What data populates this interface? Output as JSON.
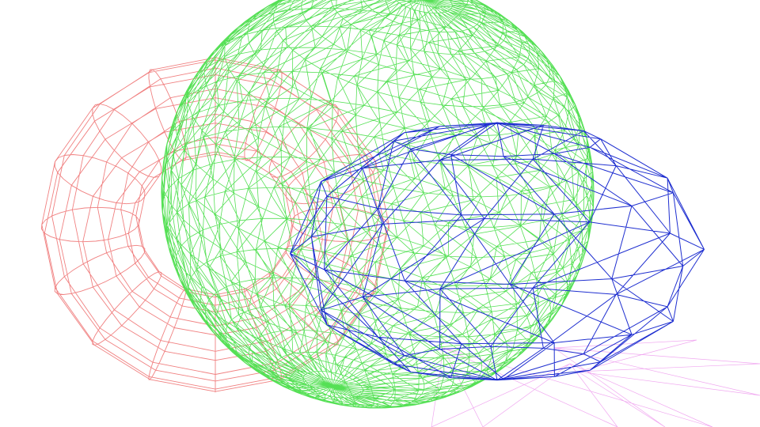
{
  "scene": {
    "background": "#ffffff",
    "objects": [
      {
        "name": "torus-wireframe",
        "shape": "torus",
        "color": "#f08080"
      },
      {
        "name": "sphere-wireframe",
        "shape": "geodesic-sphere",
        "color": "#55e055"
      },
      {
        "name": "ellipsoid-wireframe",
        "shape": "icosphere",
        "color": "#1f2fd0"
      },
      {
        "name": "ray-lines",
        "shape": "lines",
        "color": "#f0a8f0"
      }
    ]
  }
}
